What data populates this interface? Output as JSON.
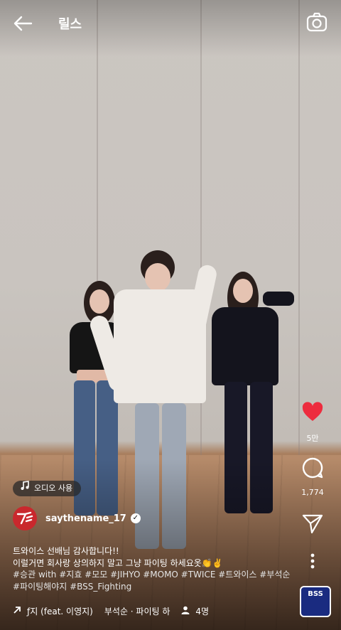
{
  "header": {
    "title": "릴스"
  },
  "icons": {
    "back": "arrow-left-icon",
    "camera": "camera-icon",
    "like": "heart-icon",
    "comment": "comment-icon",
    "share": "send-icon",
    "more": "more-vertical-icon",
    "audio": "music-note-icon",
    "verified": "verified-badge-icon",
    "audio_arrow": "arrow-up-right-icon",
    "people": "person-icon"
  },
  "colors": {
    "like": "#ed2c3e",
    "avatar": "#c9282d"
  },
  "actions": {
    "likes": "5만",
    "comments": "1,774"
  },
  "audio_chip": {
    "label": "오디오 사용"
  },
  "author": {
    "username": "saythename_17"
  },
  "caption": {
    "line1": "트와이스 선배님 감사합니다!!",
    "line2": "이럴거면 회사랑 상의하지 말고 그냥 파이팅 하세요옷👏✌️",
    "hashtags_line1": "#승관 with #지효 #모모 #JIHYO #MOMO #TWICE #트와이스 #부석순",
    "hashtags_line2": "#파이팅해야지 #BSS_Fighting"
  },
  "bottom": {
    "audio_title": "ƒ지 (feat. 이영지)",
    "audio_artist": "부석순 · 파이팅 하",
    "people_count": "4명"
  },
  "thumbnail": {
    "label": "BSS"
  }
}
